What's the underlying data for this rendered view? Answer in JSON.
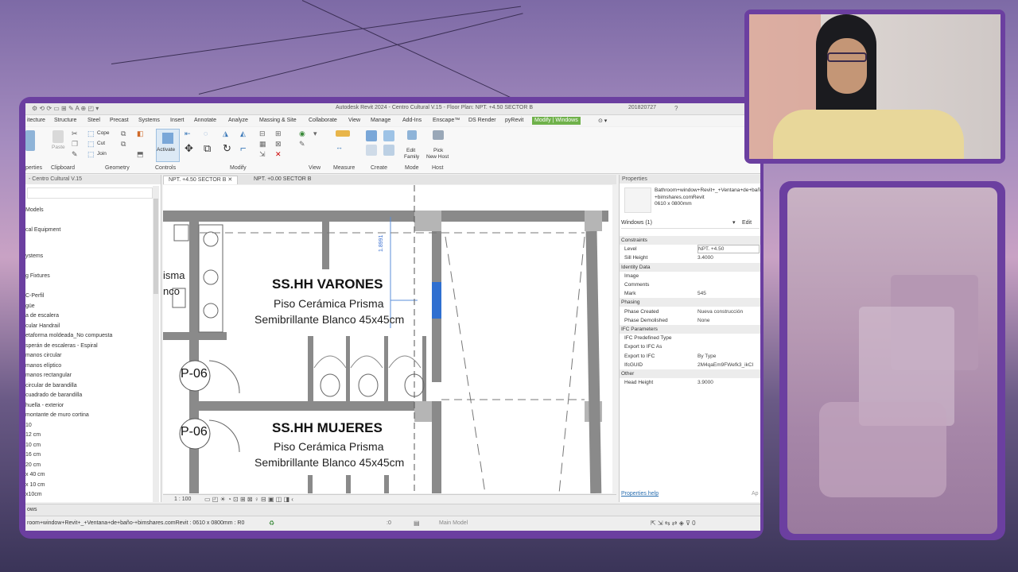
{
  "window": {
    "title": "Autodesk Revit 2024 - Centro Cultural V.15 - Floor Plan: NPT. +4.50 SECTOR B",
    "user": "201820727"
  },
  "menu": {
    "items": [
      {
        "label": "itecture"
      },
      {
        "label": "Structure"
      },
      {
        "label": "Steel"
      },
      {
        "label": "Precast"
      },
      {
        "label": "Systems"
      },
      {
        "label": "Insert"
      },
      {
        "label": "Annotate"
      },
      {
        "label": "Analyze"
      },
      {
        "label": "Massing & Site"
      },
      {
        "label": "Collaborate"
      },
      {
        "label": "View"
      },
      {
        "label": "Manage"
      },
      {
        "label": "Add-Ins"
      },
      {
        "label": "Enscape™"
      },
      {
        "label": "DS Render"
      },
      {
        "label": "pyRevit"
      },
      {
        "label": "Modify | Windows"
      }
    ]
  },
  "ribbon": {
    "groups": [
      {
        "label": "perties"
      },
      {
        "label": "Clipboard"
      },
      {
        "label": "Geometry"
      },
      {
        "label": "Controls"
      },
      {
        "label": "Modify"
      },
      {
        "label": "View"
      },
      {
        "label": "Measure"
      },
      {
        "label": "Create"
      },
      {
        "label": "Mode"
      },
      {
        "label": "Host"
      }
    ],
    "buttons": {
      "paste": "Paste",
      "cope": "Cope",
      "cut": "Cut",
      "join": "Join",
      "activate": "Activate",
      "edit_family_1": "Edit",
      "edit_family_2": "Family",
      "pick_host_1": "Pick",
      "pick_host_2": "New Host"
    }
  },
  "project_browser": {
    "title": "- Centro Cultural V.15",
    "items": [
      "Models",
      "cal Equipment",
      "ystems",
      "g Fixtures",
      "C-Perfil",
      "güe",
      "a de escalera",
      "cular Handrail",
      "etaforma moldeada_No compuesta",
      "sperán de escaleras - Espiral",
      "manos circular",
      "manos elíptico",
      "manos rectangular",
      "circular de barandilla",
      "cuadrado de barandilla",
      "huella - exterior",
      "montante de muro cortina",
      "10",
      "12 cm",
      "10 cm",
      "16 cm",
      "20 cm",
      "x 40 cm",
      "x 10 cm",
      "x10cm"
    ]
  },
  "tabs": [
    {
      "label": "NPT. +4.50 SECTOR B"
    },
    {
      "label": "NPT. +0.00 SECTOR B"
    }
  ],
  "plan": {
    "room1_title": "SS.HH VARONES",
    "room1_line1": "Piso Cerámica Prisma",
    "room1_line2": "Semibrillante Blanco 45x45cm",
    "room2_title": "SS.HH MUJERES",
    "room2_line1": "Piso Cerámica Prisma",
    "room2_line2": "Semibrillante Blanco 45x45cm",
    "left_text_1": "isma",
    "left_text_2": "nco",
    "door1": "P-06",
    "door2": "P-06",
    "dim": "1.8991"
  },
  "view_bar": {
    "scale": "1 : 100"
  },
  "properties": {
    "title": "Properties",
    "type_name": "Bathroom+window+Revit+_+Ventana+de+baño-+bimshares.comRevit",
    "type_size": "0610 x 0800mm",
    "selector": "Windows (1)",
    "edit_type": "Edit",
    "rows": [
      {
        "section": "Constraints"
      },
      {
        "k": "Level",
        "v": "NPT. +4.50"
      },
      {
        "k": "Sill Height",
        "v": "3.4000"
      },
      {
        "section": "Identity Data"
      },
      {
        "k": "Image",
        "v": ""
      },
      {
        "k": "Comments",
        "v": ""
      },
      {
        "k": "Mark",
        "v": "545"
      },
      {
        "section": "Phasing"
      },
      {
        "k": "Phase Created",
        "v": "Nueva construcción"
      },
      {
        "k": "Phase Demolished",
        "v": "None"
      },
      {
        "section": "IFC Parameters"
      },
      {
        "k": "IFC Predefined Type",
        "v": ""
      },
      {
        "k": "Export to IFC As",
        "v": ""
      },
      {
        "k": "Export to IFC",
        "v": "By Type"
      },
      {
        "k": "IfcGUID",
        "v": "2M4qaEm9FWefk3_ikCI"
      },
      {
        "section": "Other"
      },
      {
        "k": "Head Height",
        "v": "3.9000"
      }
    ],
    "help": "Properties help",
    "apply": "Ap"
  },
  "status": {
    "line1": "ows",
    "line2": "room+window+Revit+_+Ventana+de+baño-+bimshares.comRevit : 0610 x 0800mm : R0",
    "zero": ":0",
    "model": "Main Model"
  }
}
